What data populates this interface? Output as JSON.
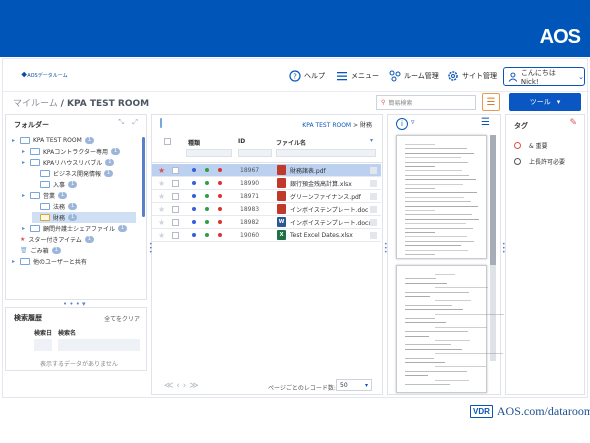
{
  "brand": {
    "logo": "AOS",
    "app_logo": "AOSデータルーム"
  },
  "nav": {
    "help": "ヘルプ",
    "menu": "メニュー",
    "room_mgmt": "ルーム管理",
    "site_mgmt": "サイト管理",
    "user": "こんにちは Nick!"
  },
  "breadcrumb": {
    "root": "マイルーム",
    "room": "/ KPA TEST ROOM"
  },
  "search": {
    "placeholder": "簡易検索"
  },
  "tools": {
    "label": "ツール"
  },
  "folders": {
    "title": "フォルダー",
    "items": [
      {
        "label": "KPA TEST ROOM",
        "badge": "1"
      },
      {
        "label": "KPAコントラクター専用",
        "badge": "1"
      },
      {
        "label": "KPAリハウスリバブル",
        "badge": "1"
      },
      {
        "label": "ビジネス開発情報",
        "badge": "1"
      },
      {
        "label": "入事",
        "badge": "1"
      },
      {
        "label": "営業",
        "badge": "1"
      },
      {
        "label": "法務",
        "badge": "1"
      },
      {
        "label": "財務",
        "badge": "1"
      },
      {
        "label": "顧問弁護士シェアファイル",
        "badge": "1"
      },
      {
        "label": "スター付きアイテム",
        "badge": "1"
      },
      {
        "label": "ごみ箱",
        "badge": "1"
      },
      {
        "label": "他のユーザーと共有",
        "badge": ""
      }
    ]
  },
  "history": {
    "title": "検索履歴",
    "clear": "全てをクリア",
    "col_date": "検索日",
    "col_name": "検索名",
    "empty": "表示するデータがありません"
  },
  "files": {
    "path_room": "KPA TEST ROOM",
    "path_sep": ">",
    "path_folder": "財務",
    "col_type": "種類",
    "col_id": "ID",
    "col_name": "ファイル名",
    "rows": [
      {
        "id": "18967",
        "name": "財務諸表.pdf",
        "type": "pdf",
        "starred": true
      },
      {
        "id": "18990",
        "name": "銀行預金残高計算.xlsx",
        "type": "pdf",
        "starred": false
      },
      {
        "id": "18971",
        "name": "グリーンファイナンス.pdf",
        "type": "pdf",
        "starred": false
      },
      {
        "id": "18983",
        "name": "インボイステンプレート.doc",
        "type": "pdf",
        "starred": false
      },
      {
        "id": "18982",
        "name": "インボイステンプレート.docx",
        "type": "word",
        "starred": false
      },
      {
        "id": "19060",
        "name": "Test Excel Dates.xlsx",
        "type": "excel",
        "starred": false
      }
    ],
    "pager_label": "ページごとのレコード数:",
    "page_size": "50"
  },
  "tags": {
    "title": "タグ",
    "items": [
      {
        "label": "& 重要",
        "color": "#d9534f"
      },
      {
        "label": "上長許可必要",
        "color": "#555555"
      }
    ]
  },
  "footer": {
    "vdr": "VDR",
    "link": "AOS.com/dataroom"
  }
}
